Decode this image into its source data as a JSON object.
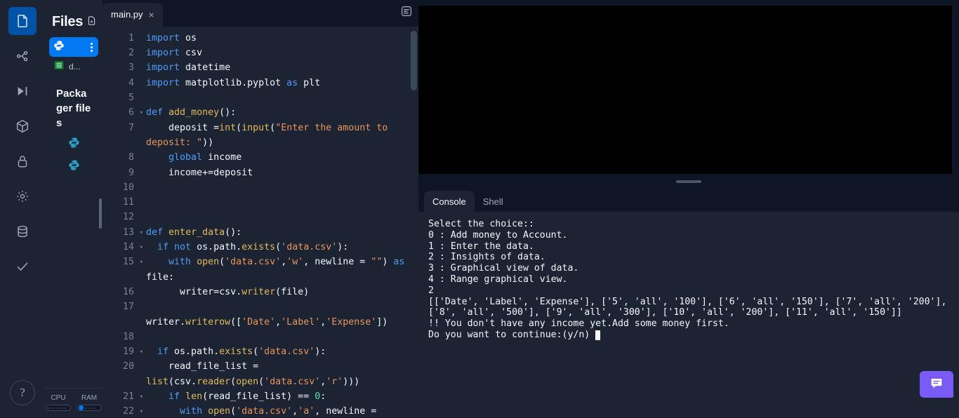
{
  "rail": {
    "items": [
      {
        "name": "files-icon",
        "active": true
      },
      {
        "name": "git-branch-icon",
        "active": false
      },
      {
        "name": "debugger-icon",
        "active": false
      },
      {
        "name": "packages-cube-icon",
        "active": false
      },
      {
        "name": "secrets-lock-icon",
        "active": false
      },
      {
        "name": "settings-gear-icon",
        "active": false
      },
      {
        "name": "database-icon",
        "active": false
      },
      {
        "name": "checkmark-icon",
        "active": false
      }
    ],
    "help_label": "?"
  },
  "files": {
    "title": "Files",
    "new_file_icon": "new-file-icon",
    "entries": [
      {
        "label": "",
        "icon": "python-icon",
        "selected": true
      },
      {
        "label": "d...",
        "icon": "csv-spreadsheet-icon",
        "selected": false
      }
    ],
    "group_title": "Packager files",
    "packager_entries": [
      {
        "icon": "python-icon"
      },
      {
        "icon": "python-icon"
      }
    ]
  },
  "usage": {
    "cpu_label": "CPU",
    "ram_label": "RAM"
  },
  "editor": {
    "tab_label": "main.py",
    "tab_close": "×",
    "tools_icon": "format-document-icon",
    "lines": [
      {
        "n": "1",
        "fold": false,
        "guides": 0,
        "tokens": [
          [
            "kw",
            "import"
          ],
          [
            "pl",
            " os"
          ]
        ]
      },
      {
        "n": "2",
        "fold": false,
        "guides": 0,
        "tokens": [
          [
            "kw",
            "import"
          ],
          [
            "pl",
            " csv"
          ]
        ]
      },
      {
        "n": "3",
        "fold": false,
        "guides": 0,
        "tokens": [
          [
            "kw",
            "import"
          ],
          [
            "pl",
            " datetime"
          ]
        ]
      },
      {
        "n": "4",
        "fold": false,
        "guides": 0,
        "tokens": [
          [
            "kw",
            "import"
          ],
          [
            "pl",
            " matplotlib.pyplot "
          ],
          [
            "kw",
            "as"
          ],
          [
            "pl",
            " plt"
          ]
        ]
      },
      {
        "n": "5",
        "fold": false,
        "guides": 0,
        "tokens": [
          [
            "pl",
            ""
          ]
        ]
      },
      {
        "n": "6",
        "fold": true,
        "guides": 0,
        "tokens": [
          [
            "kw",
            "def"
          ],
          [
            "pl",
            " "
          ],
          [
            "fn",
            "add_money"
          ],
          [
            "pl",
            "():"
          ]
        ]
      },
      {
        "n": "7",
        "fold": false,
        "guides": 1,
        "tokens": [
          [
            "pl",
            "    deposit ="
          ],
          [
            "fn",
            "int"
          ],
          [
            "pl",
            "("
          ],
          [
            "fn",
            "input"
          ],
          [
            "pl",
            "("
          ],
          [
            "str",
            "\"Enter the amount to deposit: \""
          ],
          [
            "pl",
            "))"
          ]
        ]
      },
      {
        "n": "8",
        "fold": false,
        "guides": 1,
        "tokens": [
          [
            "pl",
            "    "
          ],
          [
            "kw",
            "global"
          ],
          [
            "pl",
            " income"
          ]
        ]
      },
      {
        "n": "9",
        "fold": false,
        "guides": 1,
        "tokens": [
          [
            "pl",
            "    income+=deposit"
          ]
        ]
      },
      {
        "n": "10",
        "fold": false,
        "guides": 1,
        "tokens": [
          [
            "pl",
            ""
          ]
        ]
      },
      {
        "n": "11",
        "fold": false,
        "guides": 1,
        "tokens": [
          [
            "pl",
            ""
          ]
        ]
      },
      {
        "n": "12",
        "fold": false,
        "guides": 1,
        "tokens": [
          [
            "pl",
            ""
          ]
        ]
      },
      {
        "n": "13",
        "fold": true,
        "guides": 0,
        "tokens": [
          [
            "kw",
            "def"
          ],
          [
            "pl",
            " "
          ],
          [
            "fn",
            "enter_data"
          ],
          [
            "pl",
            "():"
          ]
        ]
      },
      {
        "n": "14",
        "fold": true,
        "guides": 1,
        "tokens": [
          [
            "pl",
            "  "
          ],
          [
            "kw",
            "if not"
          ],
          [
            "pl",
            " os.path."
          ],
          [
            "fn",
            "exists"
          ],
          [
            "pl",
            "("
          ],
          [
            "str",
            "'data.csv'"
          ],
          [
            "pl",
            "):"
          ]
        ]
      },
      {
        "n": "15",
        "fold": true,
        "guides": 2,
        "tokens": [
          [
            "pl",
            "    "
          ],
          [
            "kw",
            "with"
          ],
          [
            "pl",
            " "
          ],
          [
            "fn",
            "open"
          ],
          [
            "pl",
            "("
          ],
          [
            "str",
            "'data.csv'"
          ],
          [
            "pl",
            ","
          ],
          [
            "str",
            "'w'"
          ],
          [
            "pl",
            ", newline = "
          ],
          [
            "str",
            "\"\""
          ],
          [
            "pl",
            ") "
          ],
          [
            "kw",
            "as"
          ],
          [
            "pl",
            " file:"
          ]
        ]
      },
      {
        "n": "16",
        "fold": false,
        "guides": 3,
        "tokens": [
          [
            "pl",
            "      writer=csv."
          ],
          [
            "fn",
            "writer"
          ],
          [
            "pl",
            "(file)"
          ]
        ]
      },
      {
        "n": "17",
        "fold": false,
        "guides": 3,
        "tokens": [
          [
            "pl",
            "      writer."
          ],
          [
            "fn",
            "writerow"
          ],
          [
            "pl",
            "(["
          ],
          [
            "str",
            "'Date'"
          ],
          [
            "pl",
            ","
          ],
          [
            "str",
            "'Label'"
          ],
          [
            "pl",
            ","
          ],
          [
            "str",
            "'Expense'"
          ],
          [
            "pl",
            "])"
          ]
        ]
      },
      {
        "n": "18",
        "fold": false,
        "guides": 2,
        "tokens": [
          [
            "pl",
            ""
          ]
        ]
      },
      {
        "n": "19",
        "fold": true,
        "guides": 1,
        "tokens": [
          [
            "pl",
            "  "
          ],
          [
            "kw",
            "if"
          ],
          [
            "pl",
            " os.path."
          ],
          [
            "fn",
            "exists"
          ],
          [
            "pl",
            "("
          ],
          [
            "str",
            "'data.csv'"
          ],
          [
            "pl",
            "):"
          ]
        ]
      },
      {
        "n": "20",
        "fold": false,
        "guides": 2,
        "tokens": [
          [
            "pl",
            "    read_file_list = "
          ],
          [
            "fn",
            "list"
          ],
          [
            "pl",
            "(csv."
          ],
          [
            "fn",
            "reader"
          ],
          [
            "pl",
            "("
          ],
          [
            "fn",
            "open"
          ],
          [
            "pl",
            "("
          ],
          [
            "str",
            "'data.csv'"
          ],
          [
            "pl",
            ","
          ],
          [
            "str",
            "'r'"
          ],
          [
            "pl",
            ")))"
          ]
        ]
      },
      {
        "n": "21",
        "fold": true,
        "guides": 2,
        "tokens": [
          [
            "pl",
            "    "
          ],
          [
            "kw",
            "if"
          ],
          [
            "pl",
            " "
          ],
          [
            "fn",
            "len"
          ],
          [
            "pl",
            "(read_file_list) == "
          ],
          [
            "num",
            "0"
          ],
          [
            "pl",
            ":"
          ]
        ]
      },
      {
        "n": "22",
        "fold": true,
        "guides": 3,
        "tokens": [
          [
            "pl",
            "      "
          ],
          [
            "kw",
            "with"
          ],
          [
            "pl",
            " "
          ],
          [
            "fn",
            "open"
          ],
          [
            "pl",
            "("
          ],
          [
            "str",
            "'data.csv'"
          ],
          [
            "pl",
            ","
          ],
          [
            "str",
            "'a'"
          ],
          [
            "pl",
            ", newline = "
          ]
        ]
      }
    ]
  },
  "console": {
    "tabs": [
      {
        "label": "Console",
        "active": true
      },
      {
        "label": "Shell",
        "active": false
      }
    ],
    "output": "Select the choice::\n0 : Add money to Account.\n1 : Enter the data.\n2 : Insights of data.\n3 : Graphical view of data.\n4 : Range graphical view.\n2\n[['Date', 'Label', 'Expense'], ['5', 'all', '100'], ['6', 'all', '150'], ['7', 'all', '200'], ['8', 'all', '500'], ['9', 'all', '300'], ['10', 'all', '200'], ['11', 'all', '150']]\n!! You don't have any income yet.Add some money first.\nDo you want to continue:(y/n) "
  },
  "chat": {
    "icon": "chat-bubble-icon"
  },
  "colors": {
    "accent_blue": "#0079f2",
    "panel_bg": "#1c2333",
    "app_bg": "#0e1525",
    "webview_bg": "#000000",
    "chat_purple": "#7b5bf7",
    "keyword": "#4d9cf6",
    "function": "#e3ba5a",
    "string": "#e8965a",
    "number": "#5ce0a3",
    "text": "#f5f9fc"
  }
}
